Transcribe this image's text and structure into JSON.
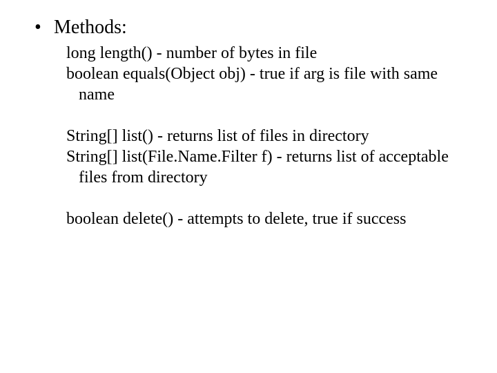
{
  "bullet": {
    "dot": "•",
    "title": "Methods:"
  },
  "methods": {
    "m1": "long length() - number of bytes in file",
    "m2": "boolean equals(Object obj) - true if arg is file with same name",
    "m3": "String[] list() - returns list of files in directory",
    "m4": "String[] list(File.Name.Filter f) - returns list of acceptable files from directory",
    "m5": "boolean delete() - attempts to delete, true if success"
  }
}
